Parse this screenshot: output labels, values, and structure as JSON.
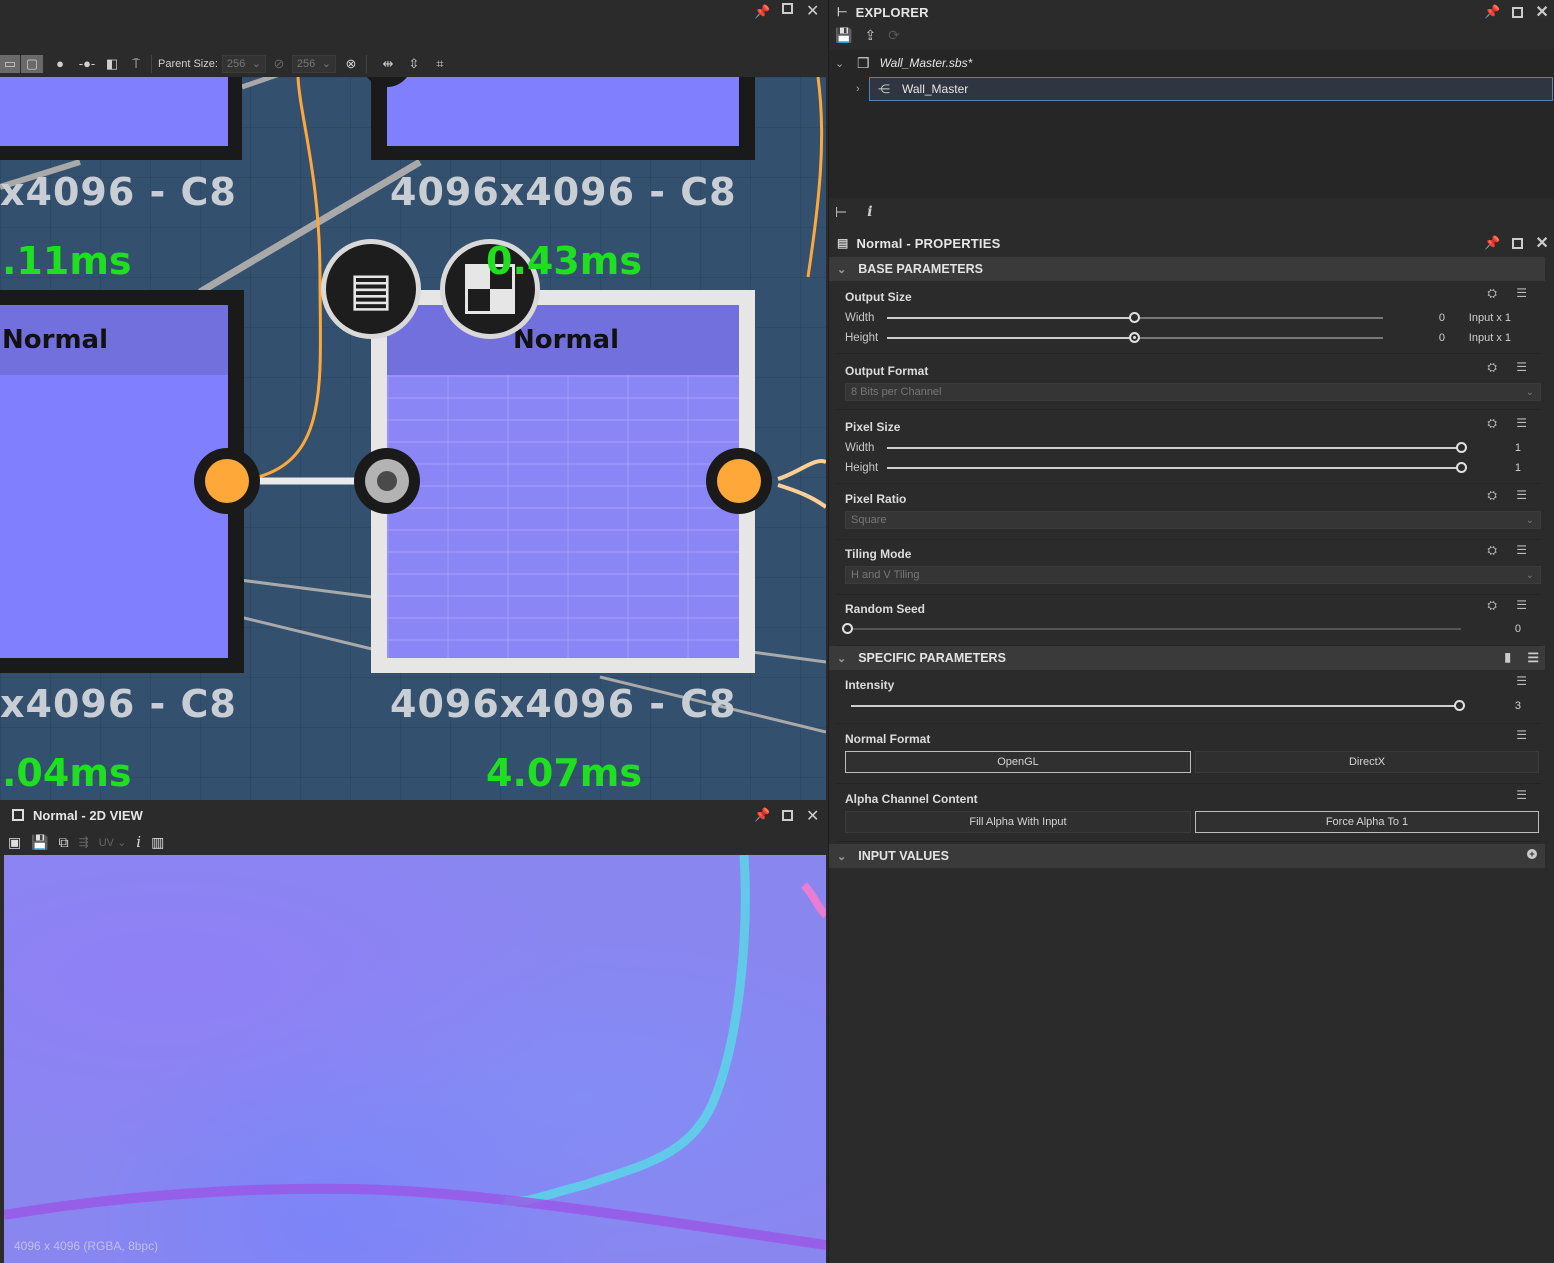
{
  "graph": {
    "toolbar": {
      "parent_size_label": "Parent Size:",
      "parent_size_w": "256",
      "parent_size_h": "256"
    },
    "nodes": [
      {
        "title": "Normal",
        "resolution": "x4096 - C8",
        "time": ".11ms"
      },
      {
        "title": "Normal",
        "resolution": "4096x4096 - C8",
        "time": "0.43ms"
      }
    ],
    "top_labels": [
      {
        "resolution": "x4096 - C8",
        "time": ".11ms"
      },
      {
        "resolution": "4096x4096 - C8",
        "time": "0.43ms"
      }
    ],
    "bottom_labels": [
      {
        "resolution": "x4096 - C8",
        "time": ".04ms"
      },
      {
        "resolution": "4096x4096 - C8",
        "time": "4.07ms"
      }
    ],
    "colors": {
      "canvas": "#34506f",
      "node_preview": "#8080ff",
      "node_header": "#7270dc",
      "connector_orange": "#ffa83a",
      "time_green": "#1fe01f"
    }
  },
  "view2d": {
    "title": "Normal - 2D VIEW",
    "uv_label": "UV",
    "status": "4096 x 4096 (RGBA, 8bpc)"
  },
  "explorer": {
    "title": "EXPLORER",
    "package": "Wall_Master.sbs*",
    "graph": "Wall_Master"
  },
  "properties": {
    "title": "Normal - PROPERTIES",
    "base_header": "BASE PARAMETERS",
    "output_size": {
      "label": "Output Size",
      "width_label": "Width",
      "width_value": "0",
      "width_suffix": "Input x 1",
      "width_fraction": 0.5,
      "height_label": "Height",
      "height_value": "0",
      "height_suffix": "Input x 1",
      "height_fraction": 0.5
    },
    "output_format": {
      "label": "Output Format",
      "value": "8 Bits per Channel"
    },
    "pixel_size": {
      "label": "Pixel Size",
      "width_label": "Width",
      "width_value": "1",
      "width_fraction": 1.0,
      "height_label": "Height",
      "height_value": "1",
      "height_fraction": 1.0
    },
    "pixel_ratio": {
      "label": "Pixel Ratio",
      "value": "Square"
    },
    "tiling_mode": {
      "label": "Tiling Mode",
      "value": "H and V Tiling"
    },
    "random_seed": {
      "label": "Random Seed",
      "value": "0",
      "fraction": 0.0
    },
    "specific_header": "SPECIFIC PARAMETERS",
    "intensity": {
      "label": "Intensity",
      "value": "3",
      "fraction": 1.0
    },
    "normal_format": {
      "label": "Normal Format",
      "options": [
        "OpenGL",
        "DirectX"
      ],
      "selected": "OpenGL"
    },
    "alpha_channel": {
      "label": "Alpha Channel Content",
      "options": [
        "Fill Alpha With Input",
        "Force Alpha To 1"
      ],
      "selected": "Force Alpha To 1"
    },
    "input_header": "INPUT VALUES"
  }
}
